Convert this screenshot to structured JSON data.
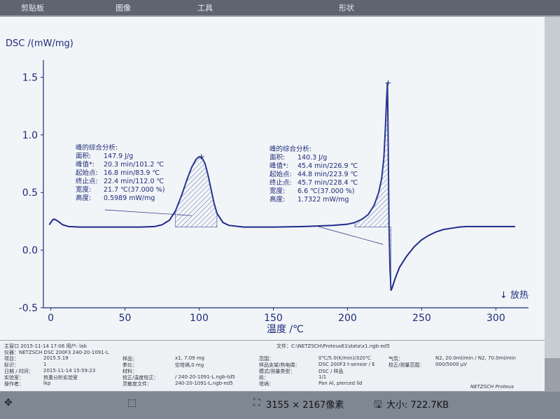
{
  "menubar": {
    "items": [
      "剪贴板",
      "图像",
      "工具",
      "形状"
    ]
  },
  "chart_data": {
    "type": "line",
    "ylabel": "DSC /(mW/mg)",
    "xlabel": "温度 /℃",
    "xlim": [
      -5,
      322
    ],
    "ylim": [
      -0.5,
      1.6
    ],
    "xticks": [
      0,
      50,
      100,
      150,
      200,
      250,
      300
    ],
    "yticks": [
      -0.5,
      0.0,
      0.5,
      1.0,
      1.5
    ],
    "tick_labels_x": [
      "0",
      "50",
      "100",
      "150",
      "200",
      "250",
      "300"
    ],
    "tick_labels_y": [
      "-0.5",
      "0.0",
      "0.5",
      "1.0",
      "1.5"
    ],
    "exo_label": "↓ 放热",
    "series": [
      {
        "x": [
          -1,
          0,
          1,
          2,
          3,
          5,
          8,
          12,
          20,
          40,
          60,
          70,
          75,
          80,
          84,
          88,
          92,
          95,
          98,
          100,
          102,
          104,
          106,
          108,
          110,
          112,
          116,
          120,
          130,
          150,
          170,
          190,
          200,
          205,
          210,
          214,
          218,
          221,
          223,
          224.5,
          225.5,
          226.3,
          226.9,
          227.2,
          227.6,
          228,
          228.6,
          229.3,
          230,
          232,
          235,
          240,
          245,
          250,
          255,
          260,
          265,
          270,
          275,
          280,
          290,
          300,
          310,
          313
        ],
        "y": [
          0.22,
          0.24,
          0.26,
          0.27,
          0.265,
          0.25,
          0.22,
          0.205,
          0.2,
          0.2,
          0.2,
          0.205,
          0.22,
          0.26,
          0.34,
          0.47,
          0.62,
          0.72,
          0.79,
          0.81,
          0.8,
          0.75,
          0.65,
          0.53,
          0.41,
          0.32,
          0.24,
          0.215,
          0.2,
          0.2,
          0.205,
          0.215,
          0.225,
          0.24,
          0.27,
          0.31,
          0.39,
          0.5,
          0.62,
          0.8,
          1.05,
          1.3,
          1.45,
          1.2,
          0.7,
          0.2,
          -0.15,
          -0.35,
          -0.33,
          -0.25,
          -0.15,
          -0.05,
          0.03,
          0.09,
          0.13,
          0.16,
          0.18,
          0.19,
          0.2,
          0.205,
          0.205,
          0.205,
          0.205,
          0.205
        ]
      }
    ],
    "peaks": [
      {
        "header": "峰的综合分析:",
        "rows": [
          [
            "面积:",
            "147.9 J/g"
          ],
          [
            "峰值*:",
            "20.3 min/101.2 ℃"
          ],
          [
            "起始点:",
            "16.8 min/83.9 ℃"
          ],
          [
            "终止点:",
            "22.4 min/112.0 ℃"
          ],
          [
            "宽度:",
            "21.7 ℃(37.000 %)"
          ],
          [
            "高度:",
            "0.5989 mW/mg"
          ]
        ]
      },
      {
        "header": "峰的综合分析:",
        "rows": [
          [
            "面积:",
            "140.3 J/g"
          ],
          [
            "峰值*:",
            "45.4 min/226.9 ℃"
          ],
          [
            "起始点:",
            "44.8 min/223.9 ℃"
          ],
          [
            "终止点:",
            "45.7 min/228.4 ℃"
          ],
          [
            "宽度:",
            "6.6 ℃(37.000 %)"
          ],
          [
            "高度:",
            "1.7322 mW/mg"
          ]
        ]
      }
    ]
  },
  "footer": {
    "header_line": "主窗口   2015-11-14 17:06   用户: lab",
    "file": "文件：C:\\NETZSCH\\Proteus61\\data\\x1.ngb-ed5",
    "instrument": "仪器：NETZSCH DSC 200F3 240-20-1091-L",
    "rows": [
      [
        "项目：",
        "2015.5.19"
      ],
      [
        "标识：",
        "1"
      ],
      [
        "日期 / 时间：",
        "2015-11-14 15:59:23"
      ],
      [
        "实验室：",
        "热重分析实验室"
      ],
      [
        "操作者：",
        "lkp"
      ]
    ],
    "mid": [
      [
        "样品：",
        "x1, 7.09 mg"
      ],
      [
        "参比：",
        "空坩埚,0 mg"
      ],
      [
        "材料：",
        ""
      ],
      [
        "校正/温度校正：",
        "/ 240-20-1091-L.ngb-td5"
      ],
      [
        "灵敏度文件：",
        "240-20-1091-L.ngb-ed5"
      ]
    ],
    "right": [
      [
        "范围：",
        "0℃/5.0(K/min)/320℃"
      ],
      [
        "样品支架/热电偶：",
        "DSC 200F3 t-sensor / E"
      ],
      [
        "模式/测量类型：",
        "DSC / 样品"
      ],
      [
        "段：",
        "1/1"
      ],
      [
        "坩埚：",
        "Pan Al, pierced lid"
      ]
    ],
    "far": [
      [
        "气氛：",
        "N2, 20.0ml/min / N2, 70.0ml/min"
      ],
      [
        "校正/测量范围：",
        "000/5000 μV"
      ]
    ],
    "brand": "NETZSCH Proteus"
  },
  "taskbar": {
    "dimensions": "3155 × 2167像素",
    "size": "大小: 722.7KB"
  }
}
